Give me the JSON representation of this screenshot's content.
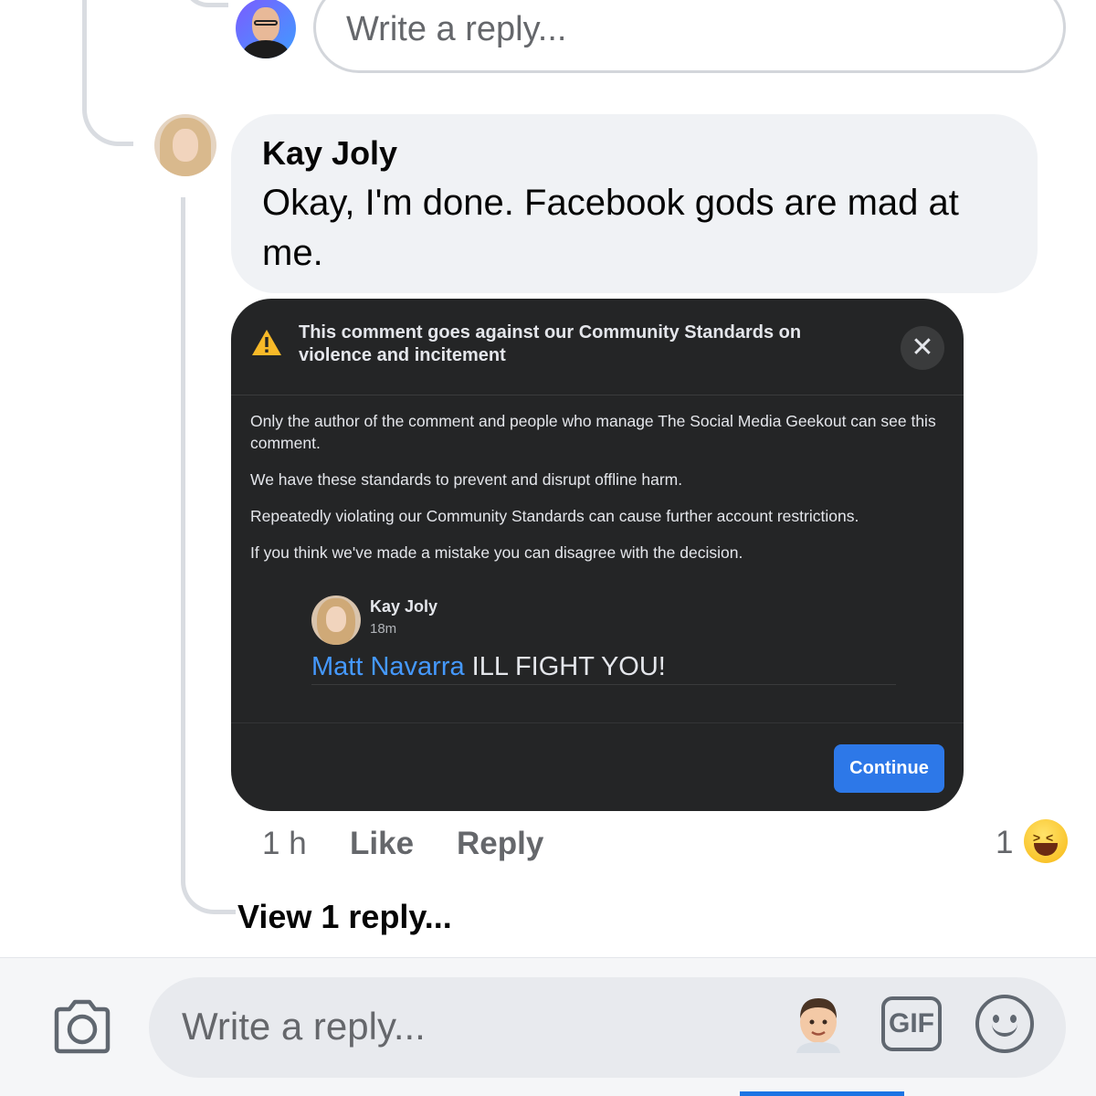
{
  "top_reply": {
    "placeholder": "Write a reply..."
  },
  "comment": {
    "author": "Kay Joly",
    "text": "Okay, I'm done. Facebook gods are mad at me.",
    "time": "1 h",
    "like_label": "Like",
    "reply_label": "Reply",
    "reaction_count": "1",
    "reaction_icon": "laughing-emoji-icon",
    "view_replies_label": "View 1 reply..."
  },
  "notice": {
    "title": "This comment goes against our Community Standards on violence and incitement",
    "close_icon": "close-icon",
    "paragraphs": [
      "Only the author of the comment and people who manage The Social Media Geekout can see this comment.",
      "We have these standards to prevent and disrupt offline harm.",
      "Repeatedly violating our Community Standards can cause further account restrictions.",
      "If you think we've made a mistake you can disagree with the decision."
    ],
    "quoted_comment": {
      "author": "Kay Joly",
      "time": "18m",
      "mention": "Matt Navarra",
      "text": "ILL FIGHT YOU!"
    },
    "continue_label": "Continue",
    "colors": {
      "card_bg": "#242526",
      "button": "#2d78e8",
      "mention": "#4599ff",
      "warning": "#f7b928"
    }
  },
  "composer": {
    "placeholder": "Write a reply...",
    "gif_label": "GIF",
    "camera_icon": "camera-icon",
    "avatar_icon": "avatar-sticker-icon",
    "emoji_icon": "smiley-icon"
  }
}
